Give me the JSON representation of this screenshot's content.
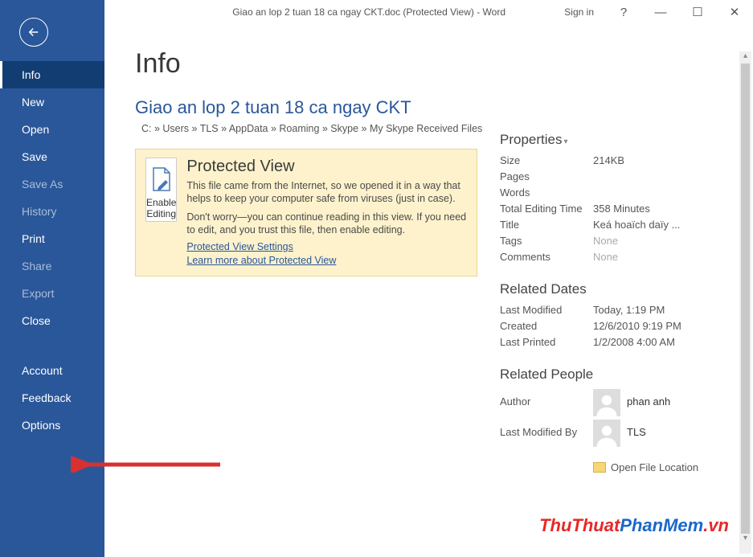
{
  "window": {
    "title": "Giao an lop 2 tuan 18 ca ngay CKT.doc (Protected View)  -  Word",
    "signin": "Sign in",
    "help": "?"
  },
  "sidebar": {
    "items": [
      {
        "label": "Info",
        "active": true
      },
      {
        "label": "New"
      },
      {
        "label": "Open"
      },
      {
        "label": "Save"
      },
      {
        "label": "Save As",
        "dim": true
      },
      {
        "label": "History",
        "dim": true
      },
      {
        "label": "Print"
      },
      {
        "label": "Share",
        "dim": true
      },
      {
        "label": "Export",
        "dim": true
      },
      {
        "label": "Close"
      },
      {
        "label": "Account",
        "sep": true
      },
      {
        "label": "Feedback"
      },
      {
        "label": "Options"
      }
    ]
  },
  "page": {
    "heading": "Info",
    "doc_title": "Giao an lop 2 tuan 18 ca ngay CKT",
    "breadcrumb": "C: » Users » TLS » AppData » Roaming » Skype » My Skype Received Files"
  },
  "protected_view": {
    "button_line1": "Enable",
    "button_line2": "Editing",
    "title": "Protected View",
    "para1": "This file came from the Internet, so we opened it in a way that helps to keep your computer safe from viruses (just in case).",
    "para2": "Don't worry—you can continue reading in this view. If you need to edit, and you trust this file, then enable editing.",
    "link1": "Protected View Settings",
    "link2": "Learn more about Protected View"
  },
  "properties": {
    "title": "Properties",
    "rows": [
      {
        "k": "Size",
        "v": "214KB"
      },
      {
        "k": "Pages",
        "v": ""
      },
      {
        "k": "Words",
        "v": ""
      },
      {
        "k": "Total Editing Time",
        "v": "358 Minutes"
      },
      {
        "k": "Title",
        "v": "Keá hoaïch daïy ..."
      },
      {
        "k": "Tags",
        "v": "None",
        "dim": true
      },
      {
        "k": "Comments",
        "v": "None",
        "dim": true
      }
    ]
  },
  "related_dates": {
    "title": "Related Dates",
    "rows": [
      {
        "k": "Last Modified",
        "v": "Today, 1:19 PM"
      },
      {
        "k": "Created",
        "v": "12/6/2010 9:19 PM"
      },
      {
        "k": "Last Printed",
        "v": "1/2/2008 4:00 AM"
      }
    ]
  },
  "related_people": {
    "title": "Related People",
    "author_label": "Author",
    "author_name": "phan anh",
    "modified_label": "Last Modified By",
    "modified_name": "TLS"
  },
  "open_file_location": "Open File Location",
  "watermark": {
    "part1": "ThuThuat",
    "part2": "PhanMem",
    "part3": ".vn"
  }
}
